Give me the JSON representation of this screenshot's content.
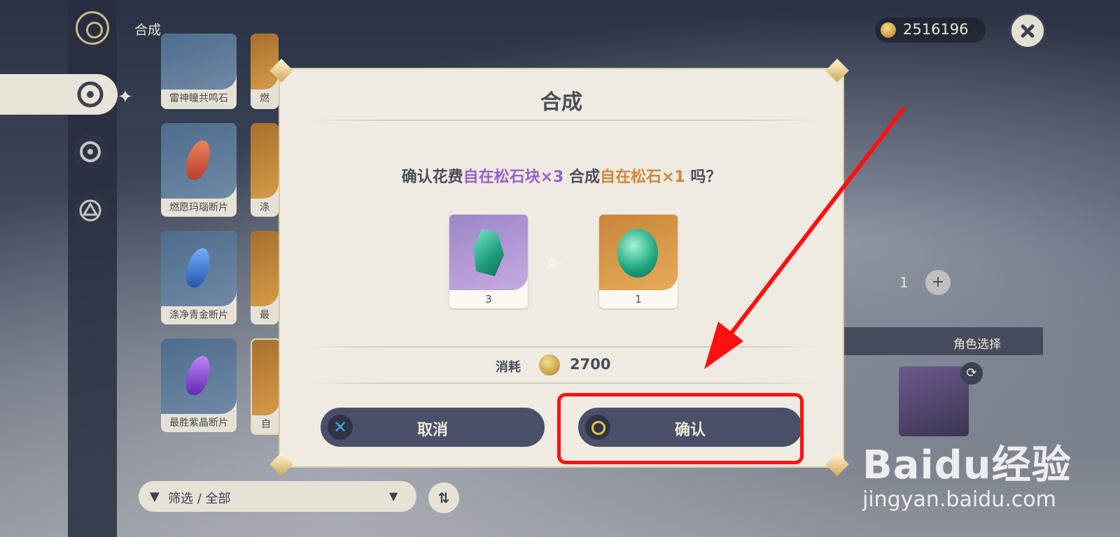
{
  "header": {
    "title": "合成",
    "currency_value": "2516196"
  },
  "background_items": [
    {
      "label": "雷神瞳共鸣石"
    },
    {
      "label": "燃愿玛瑙断片"
    },
    {
      "label": "涤净青金断片"
    },
    {
      "label": "最胜紫晶断片"
    },
    {
      "label": "燃"
    },
    {
      "label": "涤"
    },
    {
      "label": "最"
    },
    {
      "label": "自"
    }
  ],
  "filter": {
    "label": "筛选 / 全部"
  },
  "right_panel": {
    "title": "角色选择",
    "quantity": "1"
  },
  "modal": {
    "title": "合成",
    "question": {
      "prefix": "确认花费",
      "source_item": "自在松石块×3",
      "middle": " 合成",
      "target_item": "自在松石×1",
      "suffix": " 吗？"
    },
    "source_count": "3",
    "target_count": "1",
    "cost_label": "消耗",
    "cost_value": "2700",
    "cancel_label": "取消",
    "confirm_label": "确认"
  },
  "watermark": {
    "logo": "Baidu经验",
    "url": "jingyan.baidu.com"
  },
  "colors": {
    "highlight": "#ff1010",
    "button": "#4a5068",
    "purple_text": "#9a5fc9",
    "orange_text": "#d2853a"
  }
}
